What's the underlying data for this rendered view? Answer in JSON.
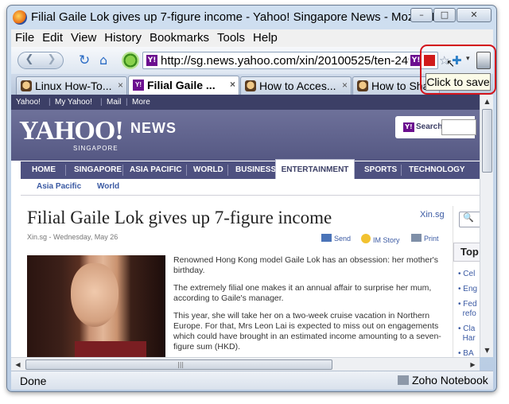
{
  "window": {
    "title": "Filial Gaile Lok gives up 7-figure income - Yahoo! Singapore News - Mozilla Fir...",
    "minimize": "–",
    "maximize": "□",
    "close": "✕"
  },
  "menubar": [
    "File",
    "Edit",
    "View",
    "History",
    "Bookmarks",
    "Tools",
    "Help"
  ],
  "navbar": {
    "back": "❮",
    "forward": "❯",
    "reload": "↻",
    "home": "⌂",
    "url": "http://sg.news.yahoo.com/xin/20100525/ten-249-fi",
    "site_badge": "Y!",
    "star": "☆",
    "add": "✚",
    "dropdown": "▾"
  },
  "tooltip": "Click to save",
  "cursor": "↖",
  "tabs": [
    {
      "label": "Linux How-To...",
      "icon": "geek-icon",
      "active": false
    },
    {
      "label": "Filial Gaile ...",
      "icon": "yahoo-icon",
      "active": true
    },
    {
      "label": "How to Acces...",
      "icon": "geek-icon",
      "active": false
    },
    {
      "label": "How to Shar",
      "icon": "geek-icon",
      "active": false
    }
  ],
  "tab_close": "×",
  "yahoo": {
    "topbar": [
      "Yahoo!",
      "My Yahoo!",
      "Mail",
      "More"
    ],
    "logo": "YAHOO!",
    "logo_sub": "SINGAPORE",
    "section": "NEWS",
    "search_label": "Search",
    "nav": [
      "HOME",
      "SINGAPORE",
      "ASIA PACIFIC",
      "WORLD",
      "BUSINESS",
      "ENTERTAINMENT",
      "SPORTS",
      "TECHNOLOGY"
    ],
    "active_nav": "ENTERTAINMENT",
    "subnav": [
      "Asia Pacific",
      "World"
    ]
  },
  "article": {
    "headline": "Filial Gaile Lok gives up 7-figure income",
    "source": "Xin.sg",
    "dateline": "Xin.sg - Wednesday, May 26",
    "tools": [
      "Send",
      "IM Story",
      "Print"
    ],
    "paragraphs": [
      "Renowned Hong Kong model Gaile Lok has an obsession: her mother's birthday.",
      "The extremely filial one makes it an annual affair to surprise her mum, according to Gaile's manager.",
      "This year, she will take her on a two-week cruise vacation in Northern Europe. For that, Mrs Leon Lai is expected to miss out on engagements which could have brought in an estimated income amounting to a seven-figure sum (HKD)."
    ]
  },
  "sidebar": {
    "top_label": "Top",
    "items": [
      "Cel",
      "Eng",
      "Fed",
      "refo",
      "Cla",
      "Har",
      "BA"
    ]
  },
  "scroll": {
    "up": "▲",
    "down": "▼",
    "left": "◀",
    "right": "▶",
    "grip": "|||"
  },
  "status": {
    "text": "Done",
    "addon": "Zoho Notebook"
  },
  "colors": {
    "yahoo_purple": "#3c3f66",
    "highlight_red": "#d3121b",
    "link_blue": "#3b5aa3"
  }
}
